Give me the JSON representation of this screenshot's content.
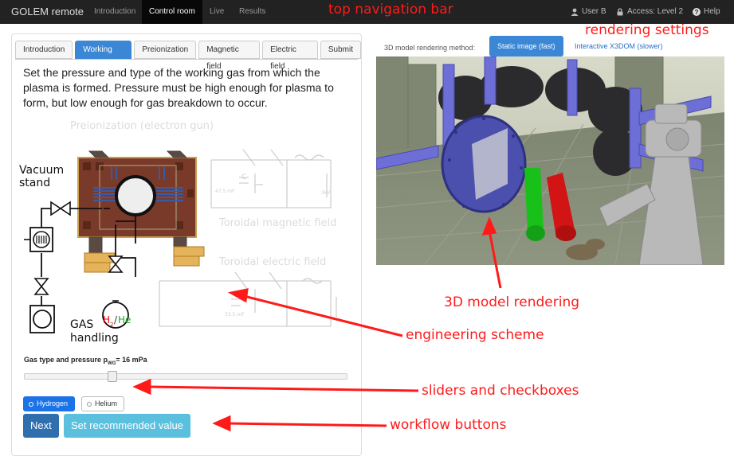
{
  "navbar": {
    "brand": "GOLEM remote",
    "items": [
      {
        "label": "Introduction",
        "active": false
      },
      {
        "label": "Control room",
        "active": true
      },
      {
        "label": "Live",
        "active": false
      },
      {
        "label": "Results",
        "active": false
      }
    ],
    "user": "User B",
    "access": "Access: Level 2",
    "help": "Help"
  },
  "annotations": {
    "top_nav": "top navigation bar",
    "rendering_settings": "rendering settings",
    "model_rendering": "3D model rendering",
    "engineering_scheme": "engineering scheme",
    "sliders": "sliders and checkboxes",
    "workflow": "workflow buttons"
  },
  "tabs": [
    {
      "label": "Introduction",
      "active": false
    },
    {
      "label": "Working gas",
      "active": true
    },
    {
      "label": "Preionization",
      "active": false
    },
    {
      "label": "Magnetic field",
      "active": false
    },
    {
      "label": "Electric field",
      "active": false
    },
    {
      "label": "Submit",
      "active": false
    }
  ],
  "description": "Set the pressure and type of the working gas from which the plasma is formed. Pressure must be high enough for plasma to form, but low enough for gas breakdown to occur.",
  "scheme": {
    "preionization": "Preionization (electron gun)",
    "toroidal_magnetic": "Toroidal magnetic field",
    "toroidal_electric": "Toroidal electric field",
    "vacuum": "Vacuum",
    "stand": "stand",
    "gas": "GAS",
    "handling": "handling",
    "h2": "H",
    "h2_sub": "2",
    "slash": "/",
    "he": "He",
    "c_label": "C",
    "cap1": "47.5 mF",
    "volt1": "3kV",
    "cap2": "33.5 mF"
  },
  "gas": {
    "label_prefix": "Gas type and pressure p",
    "label_sub": "WG",
    "label_value": "= 16 mPa",
    "slider_fraction": 0.265,
    "options": [
      {
        "label": "Hydrogen",
        "selected": true
      },
      {
        "label": "Helium",
        "selected": false
      }
    ]
  },
  "buttons": {
    "next": "Next",
    "recommended": "Set recommended value"
  },
  "render_settings": {
    "label": "3D model rendering method:",
    "static": "Static image (fast)",
    "interactive": "Interactive X3DOM (slower)"
  },
  "colors": {
    "navbar": "#222222",
    "primary": "#3b87d6",
    "next": "#2f6fad",
    "recommended": "#5bc0de",
    "annotation": "#ff1a1a"
  }
}
